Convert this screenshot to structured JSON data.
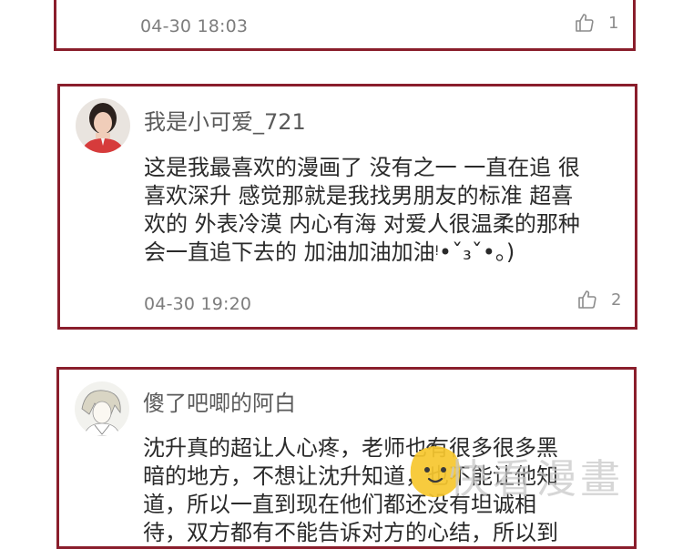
{
  "comments": [
    {
      "timestamp": "04-30 18:03",
      "likes": "1",
      "icon": "thumbs-up-icon"
    },
    {
      "username": "我是小可爱_721",
      "text_lines": [
        "这是我最喜欢的漫画了 没有之一 一直在追 很",
        "喜欢深升 感觉那就是我找男朋友的标准 超喜",
        "欢的 外表冷漠 内心有海 对爱人很温柔的那种",
        "会一直追下去的 加油加油加油ᵎ•ˇ₃ˇ•。)"
      ],
      "timestamp": "04-30 19:20",
      "likes": "2",
      "icon": "thumbs-up-icon"
    },
    {
      "username": "傻了吧唧的阿白",
      "text_lines": [
        "沈升真的超让人心疼，老师也有很多很多黑",
        "暗的地方，不想让沈升知道，也不能让他知",
        "道，所以一直到现在他们都还没有坦诚相",
        "待，双方都有不能告诉对方的心结，所以到"
      ]
    }
  ],
  "watermark": {
    "text": "快看漫畫",
    "icon": "kuaikan-mascot-icon"
  },
  "colors": {
    "card_border": "#8a1e2c",
    "meta_text": "#7d7d7d",
    "body_text": "#2a2a2a"
  }
}
